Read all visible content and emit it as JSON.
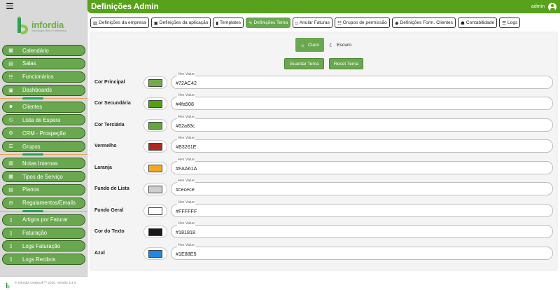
{
  "header": {
    "title": "Definições Admin",
    "user": "admin"
  },
  "logo": {
    "name": "infordia",
    "tagline": "Tecnologia, Web e Informática"
  },
  "sidebar": {
    "groups": [
      {
        "items": [
          {
            "label": "Calendário",
            "icon": "calendar-icon"
          },
          {
            "label": "Salas",
            "icon": "rooms-icon"
          },
          {
            "label": "Funcionários",
            "icon": "employees-icon"
          },
          {
            "label": "Dashboards",
            "icon": "dashboard-icon"
          }
        ]
      },
      {
        "items": [
          {
            "label": "Clientes",
            "icon": "clients-icon"
          },
          {
            "label": "Lista de Espera",
            "icon": "clock-icon"
          },
          {
            "label": "CRM - Prospeção",
            "icon": "crm-icon"
          },
          {
            "label": "Grupos",
            "icon": "groups-icon"
          }
        ]
      },
      {
        "items": [
          {
            "label": "Notas Internas",
            "icon": "notes-icon"
          },
          {
            "label": "Tipos de Serviço",
            "icon": "service-icon"
          },
          {
            "label": "Planos",
            "icon": "plans-icon"
          },
          {
            "label": "Regulamentos/Emails",
            "icon": "mail-icon"
          }
        ]
      },
      {
        "items": [
          {
            "label": "Artigos por Faturar",
            "icon": "document-icon"
          },
          {
            "label": "Faturação",
            "icon": "invoice-icon"
          },
          {
            "label": "Logs Faturação",
            "icon": "log-icon"
          },
          {
            "label": "Logs Recibos",
            "icon": "receipt-icon"
          }
        ]
      }
    ],
    "footer": "© Infordia OraBook™ 2026. Versão 3.4.0."
  },
  "tabs": [
    {
      "label": "Definições da empresa",
      "icon": "building-icon",
      "active": false
    },
    {
      "label": "Definições da aplicação",
      "icon": "app-icon",
      "active": false
    },
    {
      "label": "Templates",
      "icon": "file-icon",
      "active": false
    },
    {
      "label": "Definições Tema",
      "icon": "palette-icon",
      "active": true
    },
    {
      "label": "Anular Faturas",
      "icon": "file-x-icon",
      "active": false
    },
    {
      "label": "Grupos de permissão",
      "icon": "users-icon",
      "active": false
    },
    {
      "label": "Definições Form. Clientes",
      "icon": "user-circle-icon",
      "active": false
    },
    {
      "label": "Contabilidade",
      "icon": "accounting-icon",
      "active": false
    },
    {
      "label": "Logs",
      "icon": "list-icon",
      "active": false
    }
  ],
  "theme": {
    "light": "Claro",
    "dark": "Escuro",
    "selected": "light",
    "save_label": "Guardar Tema",
    "reset_label": "Reset Tema"
  },
  "hex_label": "Hex Value",
  "colors": [
    {
      "label": "Cor Principal",
      "value": "#72AC42"
    },
    {
      "label": "Cor Secundária",
      "value": "#4fa508"
    },
    {
      "label": "Cor Terciária",
      "value": "#62a83c"
    },
    {
      "label": "Vermelho",
      "value": "#B3261E"
    },
    {
      "label": "Laranja",
      "value": "#FAA61A"
    },
    {
      "label": "Fundo de Lista",
      "value": "#cecece"
    },
    {
      "label": "Fundo Geral",
      "value": "#FFFFFF"
    },
    {
      "label": "Cor do Texto",
      "value": "#181818"
    },
    {
      "label": "Azul",
      "value": "#1E88E5"
    }
  ]
}
